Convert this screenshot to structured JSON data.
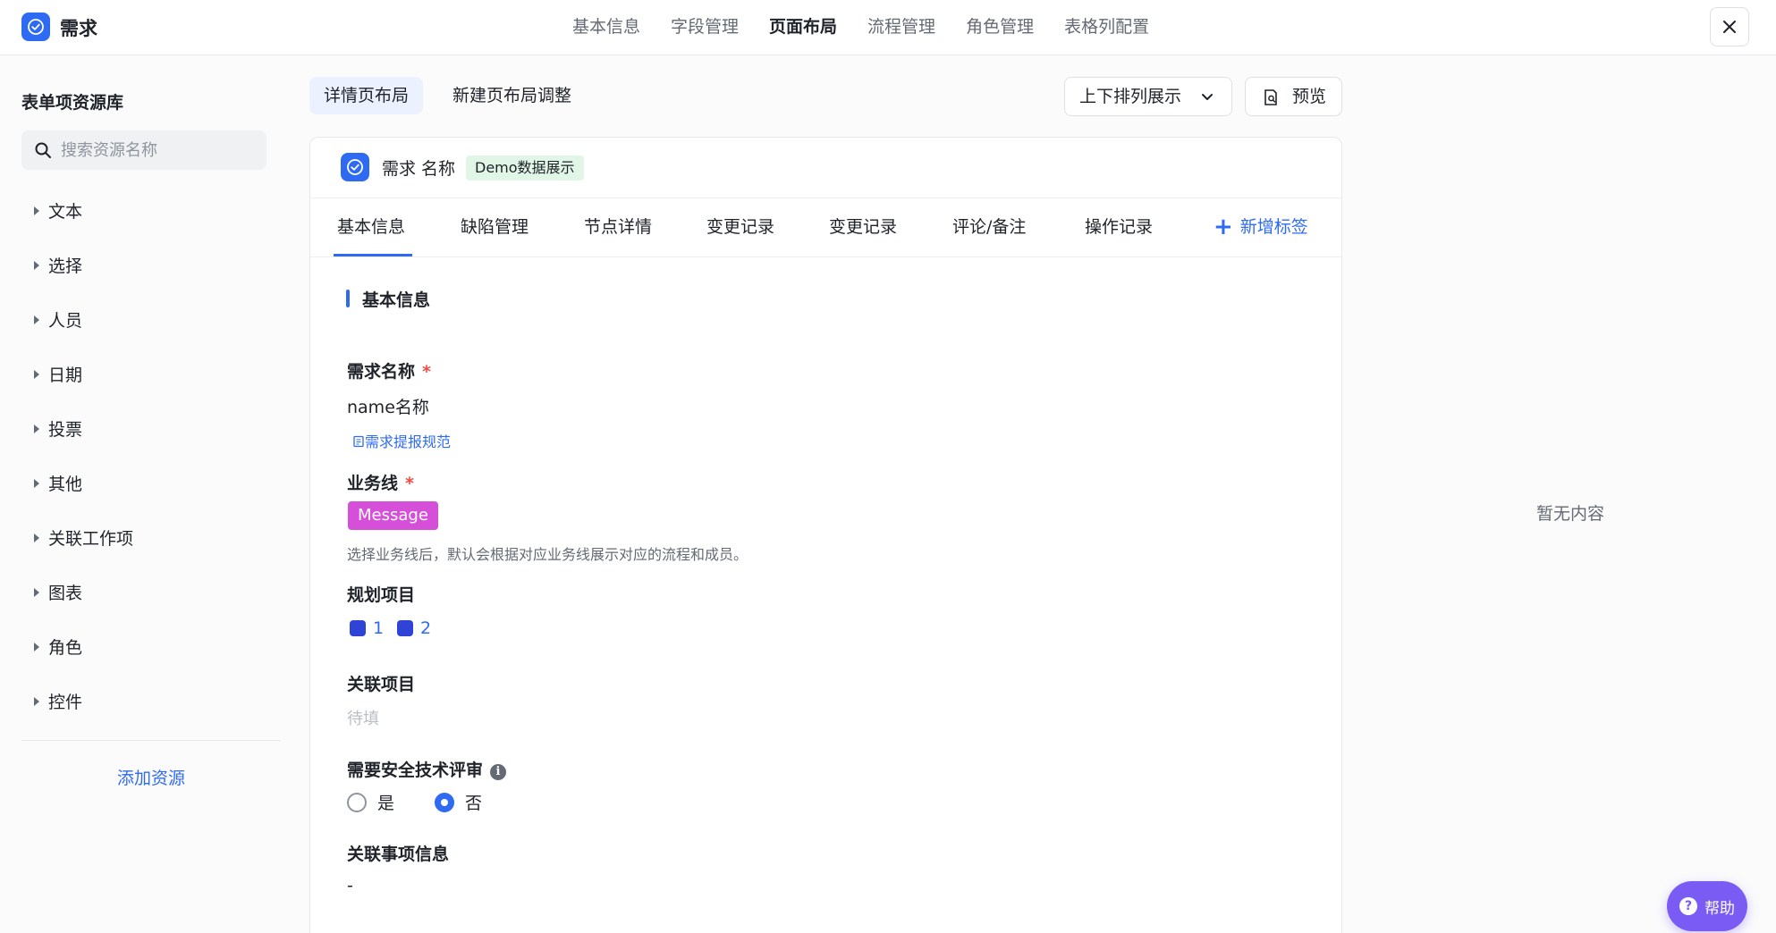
{
  "header": {
    "app_title": "需求",
    "nav": [
      "基本信息",
      "字段管理",
      "页面布局",
      "流程管理",
      "角色管理",
      "表格列配置"
    ],
    "active_nav": "页面布局"
  },
  "sidebar": {
    "title": "表单项资源库",
    "search_placeholder": "搜索资源名称",
    "categories": [
      "文本",
      "选择",
      "人员",
      "日期",
      "投票",
      "其他",
      "关联工作项",
      "图表",
      "角色",
      "控件"
    ],
    "add_resource": "添加资源"
  },
  "toolbar": {
    "tabs": [
      "详情页布局",
      "新建页布局调整"
    ],
    "active_tab": "详情页布局",
    "layout_select_value": "上下排列展示",
    "preview_label": "预览"
  },
  "card": {
    "title": "需求 名称",
    "badge": "Demo数据展示",
    "tabs": [
      "基本信息",
      "缺陷管理",
      "节点详情",
      "变更记录",
      "变更记录",
      "评论/备注",
      "操作记录"
    ],
    "active_tab": "基本信息",
    "add_tab_label": "新增标签",
    "section_title": "基本信息",
    "fields": {
      "name": {
        "label": "需求名称",
        "required_mark": "*",
        "value": "name名称",
        "link": "需求提报规范"
      },
      "business_line": {
        "label": "业务线",
        "required_mark": "*",
        "tag": "Message",
        "hint": "选择业务线后，默认会根据对应业务线展示对应的流程和成员。"
      },
      "plan_project": {
        "label": "规划项目",
        "items": [
          "1",
          "2"
        ]
      },
      "related_project": {
        "label": "关联项目",
        "placeholder": "待填"
      },
      "security_review": {
        "label": "需要安全技术评审",
        "info_glyph": "i",
        "options": [
          "是",
          "否"
        ],
        "selected": "否"
      },
      "related_info": {
        "label": "关联事项信息",
        "value": "-"
      }
    }
  },
  "right_panel": {
    "empty_text": "暂无内容"
  },
  "help": {
    "label": "帮助",
    "glyph": "?"
  },
  "colors": {
    "primary": "#2f6bf2",
    "tag_magenta": "#d64fd8",
    "badge_green": "#e2f6e8",
    "help_purple": "#7a5cf5",
    "required_red": "#f54a45"
  }
}
